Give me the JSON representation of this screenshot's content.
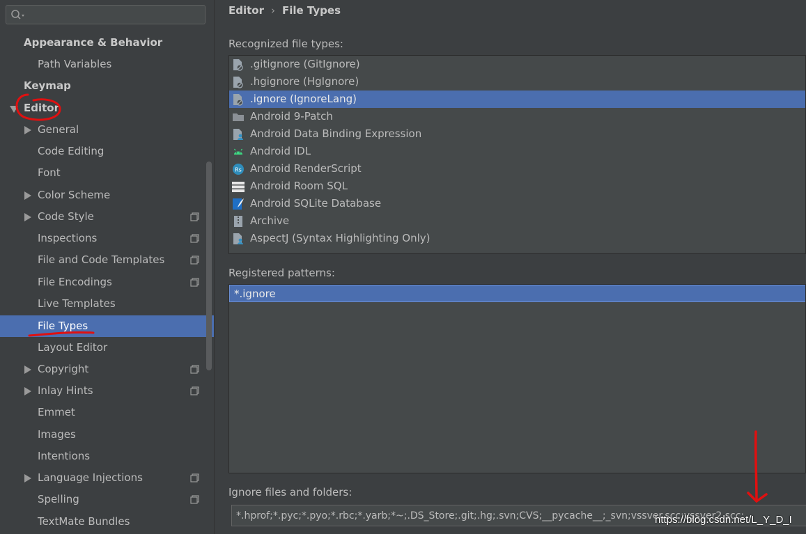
{
  "search": {
    "placeholder": "",
    "value": ""
  },
  "sidebar": {
    "items": [
      {
        "label": "Appearance & Behavior"
      },
      {
        "label": "Path Variables"
      },
      {
        "label": "Keymap"
      },
      {
        "label": "Editor"
      },
      {
        "label": "General"
      },
      {
        "label": "Code Editing"
      },
      {
        "label": "Font"
      },
      {
        "label": "Color Scheme"
      },
      {
        "label": "Code Style"
      },
      {
        "label": "Inspections"
      },
      {
        "label": "File and Code Templates"
      },
      {
        "label": "File Encodings"
      },
      {
        "label": "Live Templates"
      },
      {
        "label": "File Types"
      },
      {
        "label": "Layout Editor"
      },
      {
        "label": "Copyright"
      },
      {
        "label": "Inlay Hints"
      },
      {
        "label": "Emmet"
      },
      {
        "label": "Images"
      },
      {
        "label": "Intentions"
      },
      {
        "label": "Language Injections"
      },
      {
        "label": "Spelling"
      },
      {
        "label": "TextMate Bundles"
      }
    ],
    "selected": "File Types"
  },
  "breadcrumb": {
    "parent": "Editor",
    "separator": "›",
    "current": "File Types"
  },
  "recognized": {
    "label": "Recognized file types:",
    "items": [
      {
        "label": ".gitignore (GitIgnore)",
        "icon": "ignore-file-icon"
      },
      {
        "label": ".hgignore (HgIgnore)",
        "icon": "ignore-file-icon"
      },
      {
        "label": ".ignore (IgnoreLang)",
        "icon": "ignore-file-icon"
      },
      {
        "label": "Android 9-Patch",
        "icon": "folder-icon"
      },
      {
        "label": "Android Data Binding Expression",
        "icon": "file-user-icon"
      },
      {
        "label": "Android IDL",
        "icon": "android-icon"
      },
      {
        "label": "Android RenderScript",
        "icon": "renderscript-icon"
      },
      {
        "label": "Android Room SQL",
        "icon": "table-icon"
      },
      {
        "label": "Android SQLite Database",
        "icon": "sqlite-icon"
      },
      {
        "label": "Archive",
        "icon": "archive-icon"
      },
      {
        "label": "AspectJ (Syntax Highlighting Only)",
        "icon": "file-user-icon"
      }
    ],
    "selected_index": 2
  },
  "patterns": {
    "label": "Registered patterns:",
    "items": [
      "*.ignore"
    ]
  },
  "ignore": {
    "label": "Ignore files and folders:",
    "value": "*.hprof;*.pyc;*.pyo;*.rbc;*.yarb;*~;.DS_Store;.git;.hg;.svn;CVS;__pycache__;_svn;vssver.scc;vssver2.scc;"
  },
  "watermark": "https://blog.csdn.net/L_Y_D_I",
  "colors": {
    "background": "#3c3f41",
    "selection": "#4b6eaf",
    "list_background": "#45494a",
    "annotation_red": "#e01010",
    "text": "#bbbbbb"
  }
}
